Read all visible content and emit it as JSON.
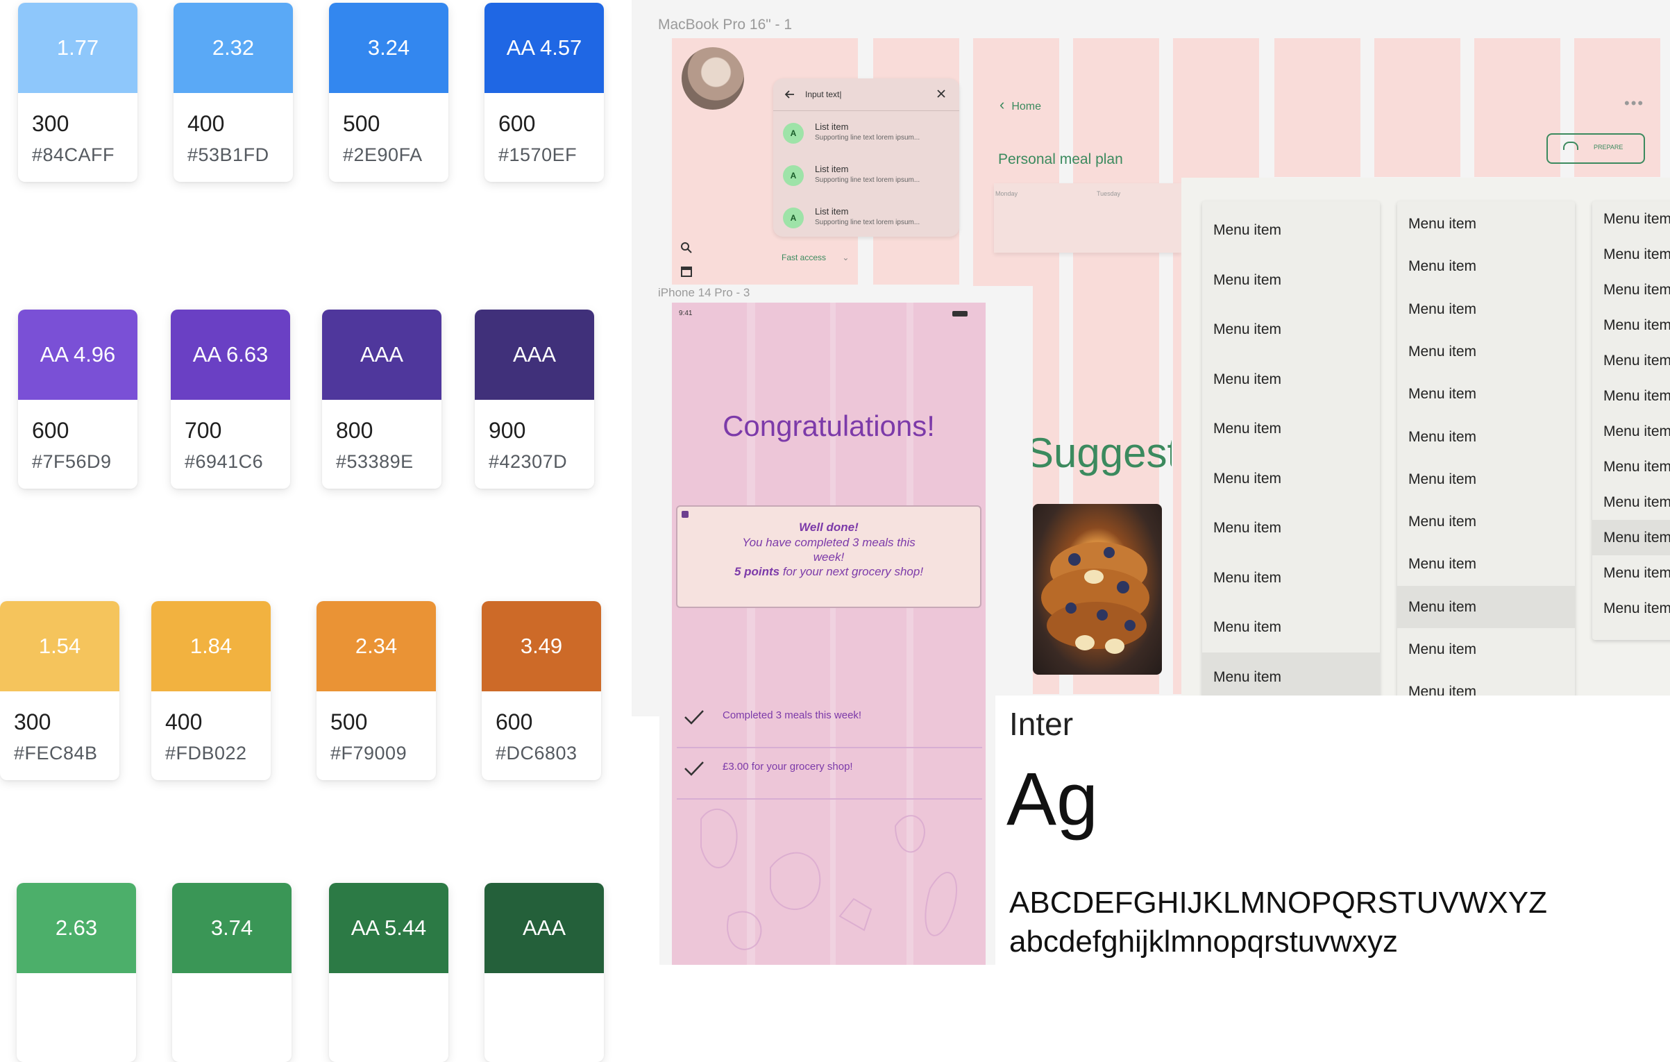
{
  "swatches": [
    {
      "label": "1.77",
      "weight": "300",
      "hex": "#84CAFF",
      "color": "#8ec7fb",
      "text": "#ffffff"
    },
    {
      "label": "2.32",
      "weight": "400",
      "hex": "#53B1FD",
      "color": "#5aa9f6",
      "text": "#ffffff"
    },
    {
      "label": "3.24",
      "weight": "500",
      "hex": "#2E90FA",
      "color": "#3387ef",
      "text": "#ffffff"
    },
    {
      "label": "AA 4.57",
      "weight": "600",
      "hex": "#1570EF",
      "color": "#1f67e4",
      "text": "#ffffff"
    },
    {
      "label": "AA 4.96",
      "weight": "600",
      "hex": "#7F56D9",
      "color": "#7a50d6",
      "text": "#ffffff"
    },
    {
      "label": "AA 6.63",
      "weight": "700",
      "hex": "#6941C6",
      "color": "#6a40c4",
      "text": "#ffffff"
    },
    {
      "label": "AAA",
      "weight": "800",
      "hex": "#53389E",
      "color": "#4f379c",
      "text": "#ffffff"
    },
    {
      "label": "AAA",
      "weight": "900",
      "hex": "#42307D",
      "color": "#40307a",
      "text": "#ffffff"
    },
    {
      "label": "1.54",
      "weight": "300",
      "hex": "#FEC84B",
      "color": "#f5c45c",
      "text": "#ffffff"
    },
    {
      "label": "1.84",
      "weight": "400",
      "hex": "#FDB022",
      "color": "#f2b240",
      "text": "#ffffff"
    },
    {
      "label": "2.34",
      "weight": "500",
      "hex": "#F79009",
      "color": "#ea9335",
      "text": "#ffffff"
    },
    {
      "label": "3.49",
      "weight": "600",
      "hex": "#DC6803",
      "color": "#cd6a28",
      "text": "#ffffff"
    },
    {
      "label": "2.63",
      "weight": "",
      "hex": "",
      "color": "#4caf6a",
      "text": "#ffffff"
    },
    {
      "label": "3.74",
      "weight": "",
      "hex": "",
      "color": "#3a9656",
      "text": "#ffffff"
    },
    {
      "label": "AA 5.44",
      "weight": "",
      "hex": "",
      "color": "#2c7a45",
      "text": "#ffffff"
    },
    {
      "label": "AAA",
      "weight": "",
      "hex": "",
      "color": "#24603a",
      "text": "#ffffff"
    }
  ],
  "macbook": {
    "frame_label": "MacBook Pro 16\" - 1",
    "search": {
      "placeholder": "Input text|",
      "items": [
        {
          "avatar": "A",
          "title": "List item",
          "sub": "Supporting line text lorem ipsum..."
        },
        {
          "avatar": "A",
          "title": "List item",
          "sub": "Supporting line text lorem ipsum..."
        },
        {
          "avatar": "A",
          "title": "List item",
          "sub": "Supporting line text lorem ipsum..."
        }
      ],
      "fast_access": "Fast access"
    },
    "breadcrumb": "Home",
    "page_title": "Personal meal plan",
    "days": [
      "Monday",
      "Tuesday"
    ],
    "prepare_label": "PREPARE",
    "suggestion_heading": "Suggesti"
  },
  "menus": {
    "item_label": "Menu item"
  },
  "iphone": {
    "frame_label": "iPhone 14 Pro - 3",
    "time": "9:41",
    "heading": "Congratulations!",
    "card": {
      "line1": "Well done!",
      "line2": "You have completed 3 meals this",
      "line3": "week!",
      "line4_bold": "5 points",
      "line4_rest": " for your next grocery shop!"
    },
    "checks": [
      "Completed 3 meals this week!",
      "£3.00 for your grocery shop!"
    ]
  },
  "typography": {
    "font_name": "Inter",
    "sample": "Ag",
    "upper": "ABCDEFGHIJKLMNOPQRSTUVWXYZ",
    "lower": "abcdefghijklmnopqrstuvwxyz"
  },
  "colors": {
    "green_heading": "#3b8a5e",
    "purple": "#7c3aa9"
  }
}
